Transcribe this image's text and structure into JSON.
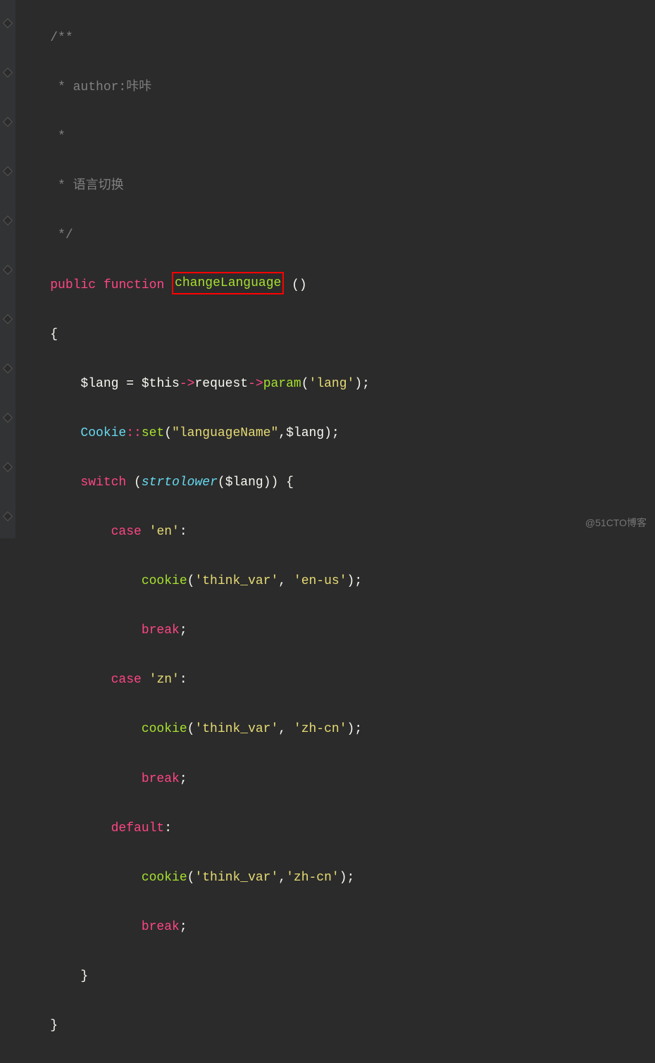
{
  "comment": {
    "l1": "/**",
    "l2": " * author:咔咔",
    "l3": " *",
    "l4": " * 语言切换",
    "l5": " */"
  },
  "code": {
    "public": "public",
    "function": "function",
    "funcName": "changeLanguage",
    "parens": "()",
    "openBrace": "{",
    "closeBrace": "}",
    "langVar": "$lang",
    "equals": " = ",
    "thisVar": "$this",
    "arrow": "->",
    "request": "request",
    "param": "param",
    "paramArg": "'lang'",
    "cookieClass": "Cookie",
    "dcolon": "::",
    "set": "set",
    "setArg1": "\"languageName\"",
    "setArg2": "$lang",
    "switch": "switch",
    "strtolower": "strtolower",
    "case": "case",
    "caseEn": "'en'",
    "caseZn": "'zn'",
    "default": "default",
    "cookie": "cookie",
    "thinkVar": "'think_var'",
    "enUs": "'en-us'",
    "zhCn": "'zh-cn'",
    "break": "break",
    "semi": ";",
    "comma": ",",
    "colon": ":",
    "openParen": "(",
    "closeParen": ")",
    "space": " "
  },
  "watermark": "@51CTO博客"
}
